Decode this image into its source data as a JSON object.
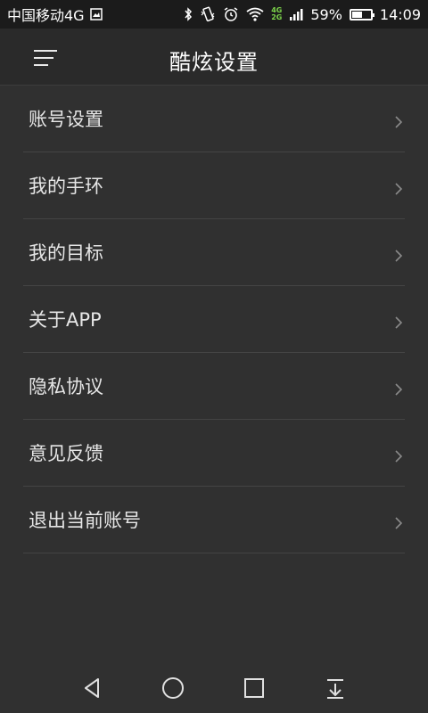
{
  "status_bar": {
    "carrier": "中国移动4G",
    "battery_percent": "59%",
    "battery_level": 0.59,
    "time": "14:09",
    "network_badge_top": "4G",
    "network_badge_bottom": "2G",
    "icons": [
      "image-icon",
      "bluetooth-icon",
      "vibrate-icon",
      "alarm-icon",
      "wifi-icon",
      "signal-icon",
      "battery-icon"
    ]
  },
  "header": {
    "title": "酷炫设置",
    "menu_icon": "menu-icon"
  },
  "settings": {
    "items": [
      {
        "label": "账号设置"
      },
      {
        "label": "我的手环"
      },
      {
        "label": "我的目标"
      },
      {
        "label": "关于APP"
      },
      {
        "label": "隐私协议"
      },
      {
        "label": "意见反馈"
      },
      {
        "label": "退出当前账号"
      }
    ]
  },
  "nav_bar": {
    "icons": [
      "back-icon",
      "home-icon",
      "recents-icon",
      "notification-pull-icon"
    ]
  },
  "colors": {
    "background": "#303030",
    "status_bar": "#1b1b1b",
    "title_bar": "#2a2a2a",
    "text": "#e6e6e6",
    "divider": "#444444"
  }
}
